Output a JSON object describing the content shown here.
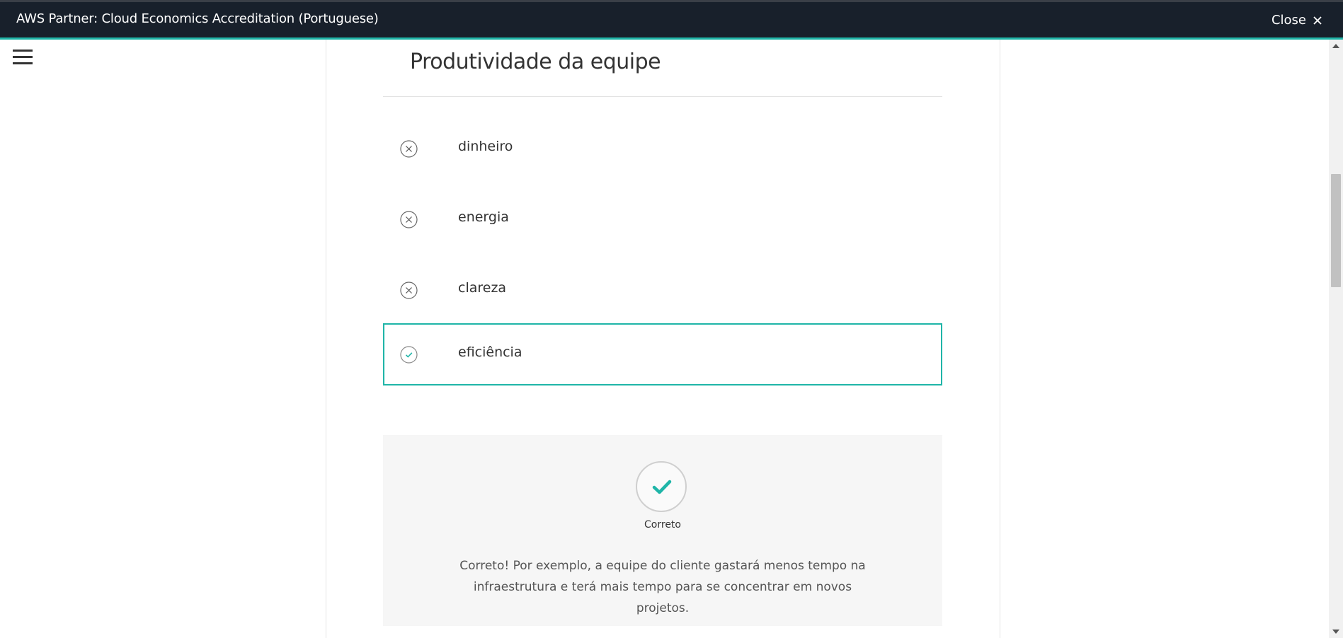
{
  "window": {
    "title": "AWS Partner: Cloud Economics Accreditation (Portuguese)",
    "close_label": "Close"
  },
  "question": {
    "heading": "Produtividade da equipe",
    "options": [
      {
        "label": "dinheiro",
        "state": "incorrect",
        "icon": "x-circle-icon"
      },
      {
        "label": "energia",
        "state": "incorrect",
        "icon": "x-circle-icon"
      },
      {
        "label": "clareza",
        "state": "incorrect",
        "icon": "x-circle-icon"
      },
      {
        "label": "eficiência",
        "state": "correct-selected",
        "icon": "check-circle-icon"
      }
    ]
  },
  "feedback": {
    "status": "Correto",
    "message": "Correto! Por exemplo, a equipe do cliente gastará menos tempo na infraestrutura e terá mais tempo para se concentrar em novos projetos."
  },
  "colors": {
    "accent": "#1fb5a8",
    "titlebar": "#18202b"
  }
}
